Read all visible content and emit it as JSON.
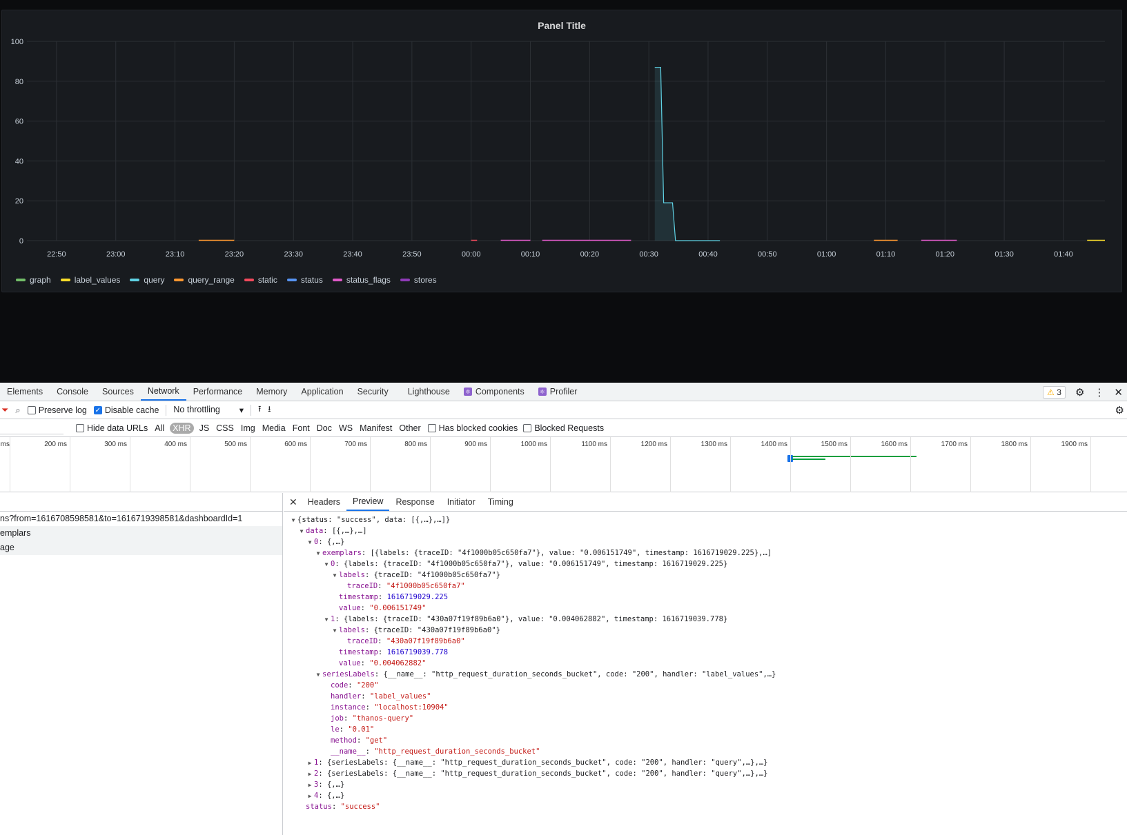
{
  "panel": {
    "title": "Panel Title"
  },
  "chart_data": {
    "type": "line",
    "title": "Panel Title",
    "ylim": [
      0,
      100
    ],
    "yticks": [
      "0",
      "20",
      "40",
      "60",
      "80",
      "100"
    ],
    "x_ticks": [
      "22:50",
      "23:00",
      "23:10",
      "23:20",
      "23:30",
      "23:40",
      "23:50",
      "00:00",
      "00:10",
      "00:20",
      "00:30",
      "00:40",
      "00:50",
      "01:00",
      "01:10",
      "01:20",
      "01:30",
      "01:40"
    ],
    "x_range": [
      "22:45",
      "01:47"
    ],
    "grid": true,
    "legend_placement": "bottom-left",
    "series": [
      {
        "name": "graph",
        "color": "#73bf69",
        "points": []
      },
      {
        "name": "label_values",
        "color": "#fade2a",
        "points": [
          [
            "01:44",
            0
          ],
          [
            "01:47",
            0
          ]
        ]
      },
      {
        "name": "query",
        "color": "#5fd2e4",
        "points": [
          [
            "00:31",
            87
          ],
          [
            "00:32",
            87
          ],
          [
            "00:32.5",
            19
          ],
          [
            "00:34",
            19
          ],
          [
            "00:34.5",
            0
          ],
          [
            "00:42",
            0
          ]
        ]
      },
      {
        "name": "query_range",
        "color": "#ff9830",
        "points": [
          [
            "23:14",
            0
          ],
          [
            "23:20",
            0
          ],
          [
            "01:08",
            0
          ],
          [
            "01:12",
            0
          ]
        ]
      },
      {
        "name": "static",
        "color": "#f2495c",
        "points": [
          [
            "00:00",
            0
          ],
          [
            "00:01",
            0
          ]
        ]
      },
      {
        "name": "status",
        "color": "#5794f2",
        "points": []
      },
      {
        "name": "status_flags",
        "color": "#e05ac9",
        "points": [
          [
            "00:05",
            0
          ],
          [
            "00:10",
            0
          ],
          [
            "00:12",
            0
          ],
          [
            "00:27",
            0
          ],
          [
            "01:16",
            0
          ],
          [
            "01:22",
            0
          ]
        ]
      },
      {
        "name": "stores",
        "color": "#8f3bb8",
        "points": []
      }
    ]
  },
  "devtools": {
    "tabs": [
      "Elements",
      "Console",
      "Sources",
      "Network",
      "Performance",
      "Memory",
      "Application",
      "Security",
      "Lighthouse",
      "Components",
      "Profiler"
    ],
    "active_tab": "Network",
    "warning_count": "3",
    "toolbar": {
      "preserve_log": "Preserve log",
      "disable_cache": "Disable cache",
      "throttling": "No throttling"
    },
    "filters": {
      "hide_data_urls": "Hide data URLs",
      "types": [
        "All",
        "XHR",
        "JS",
        "CSS",
        "Img",
        "Media",
        "Font",
        "Doc",
        "WS",
        "Manifest",
        "Other"
      ],
      "active_type": "XHR",
      "has_blocked_cookies": "Has blocked cookies",
      "blocked_requests": "Blocked Requests"
    },
    "timeline_labels": [
      "ms",
      "200 ms",
      "300 ms",
      "400 ms",
      "500 ms",
      "600 ms",
      "700 ms",
      "800 ms",
      "900 ms",
      "1000 ms",
      "1100 ms",
      "1200 ms",
      "1300 ms",
      "1400 ms",
      "1500 ms",
      "1600 ms",
      "1700 ms",
      "1800 ms",
      "1900 ms",
      "20"
    ],
    "requests": [
      "ns?from=1616708598581&to=1616719398581&dashboardId=1",
      "emplars",
      "age"
    ],
    "detail_tabs": [
      "Headers",
      "Preview",
      "Response",
      "Initiator",
      "Timing"
    ],
    "active_detail_tab": "Preview",
    "preview_lines": [
      {
        "i": 0,
        "t": "▼",
        "k": "",
        "v": "{status: \"success\", data: [{,…},…]}"
      },
      {
        "i": 1,
        "t": "▼",
        "k": "data",
        "v": "[{,…},…]"
      },
      {
        "i": 2,
        "t": "▼",
        "k": "0",
        "v": "{,…}"
      },
      {
        "i": 3,
        "t": "▼",
        "k": "exemplars",
        "v": "[{labels: {traceID: \"4f1000b05c650fa7\"}, value: \"0.006151749\", timestamp: 1616719029.225},…]"
      },
      {
        "i": 4,
        "t": "▼",
        "k": "0",
        "v": "{labels: {traceID: \"4f1000b05c650fa7\"}, value: \"0.006151749\", timestamp: 1616719029.225}"
      },
      {
        "i": 5,
        "t": "▼",
        "k": "labels",
        "v": "{traceID: \"4f1000b05c650fa7\"}"
      },
      {
        "i": 6,
        "t": "",
        "k": "traceID",
        "v": "\"4f1000b05c650fa7\"",
        "c": "s"
      },
      {
        "i": 5,
        "t": "",
        "k": "timestamp",
        "v": "1616719029.225",
        "c": "n"
      },
      {
        "i": 5,
        "t": "",
        "k": "value",
        "v": "\"0.006151749\"",
        "c": "s"
      },
      {
        "i": 4,
        "t": "▼",
        "k": "1",
        "v": "{labels: {traceID: \"430a07f19f89b6a0\"}, value: \"0.004062882\", timestamp: 1616719039.778}"
      },
      {
        "i": 5,
        "t": "▼",
        "k": "labels",
        "v": "{traceID: \"430a07f19f89b6a0\"}"
      },
      {
        "i": 6,
        "t": "",
        "k": "traceID",
        "v": "\"430a07f19f89b6a0\"",
        "c": "s"
      },
      {
        "i": 5,
        "t": "",
        "k": "timestamp",
        "v": "1616719039.778",
        "c": "n"
      },
      {
        "i": 5,
        "t": "",
        "k": "value",
        "v": "\"0.004062882\"",
        "c": "s"
      },
      {
        "i": 3,
        "t": "▼",
        "k": "seriesLabels",
        "v": "{__name__: \"http_request_duration_seconds_bucket\", code: \"200\", handler: \"label_values\",…}"
      },
      {
        "i": 4,
        "t": "",
        "k": "code",
        "v": "\"200\"",
        "c": "s"
      },
      {
        "i": 4,
        "t": "",
        "k": "handler",
        "v": "\"label_values\"",
        "c": "s"
      },
      {
        "i": 4,
        "t": "",
        "k": "instance",
        "v": "\"localhost:10904\"",
        "c": "s"
      },
      {
        "i": 4,
        "t": "",
        "k": "job",
        "v": "\"thanos-query\"",
        "c": "s"
      },
      {
        "i": 4,
        "t": "",
        "k": "le",
        "v": "\"0.01\"",
        "c": "s"
      },
      {
        "i": 4,
        "t": "",
        "k": "method",
        "v": "\"get\"",
        "c": "s"
      },
      {
        "i": 4,
        "t": "",
        "k": "__name__",
        "v": "\"http_request_duration_seconds_bucket\"",
        "c": "s"
      },
      {
        "i": 2,
        "t": "▶",
        "k": "1",
        "v": "{seriesLabels: {__name__: \"http_request_duration_seconds_bucket\", code: \"200\", handler: \"query\",…},…}"
      },
      {
        "i": 2,
        "t": "▶",
        "k": "2",
        "v": "{seriesLabels: {__name__: \"http_request_duration_seconds_bucket\", code: \"200\", handler: \"query\",…},…}"
      },
      {
        "i": 2,
        "t": "▶",
        "k": "3",
        "v": "{,…}"
      },
      {
        "i": 2,
        "t": "▶",
        "k": "4",
        "v": "{,…}"
      },
      {
        "i": 1,
        "t": "",
        "k": "status",
        "v": "\"success\"",
        "c": "s"
      }
    ]
  }
}
